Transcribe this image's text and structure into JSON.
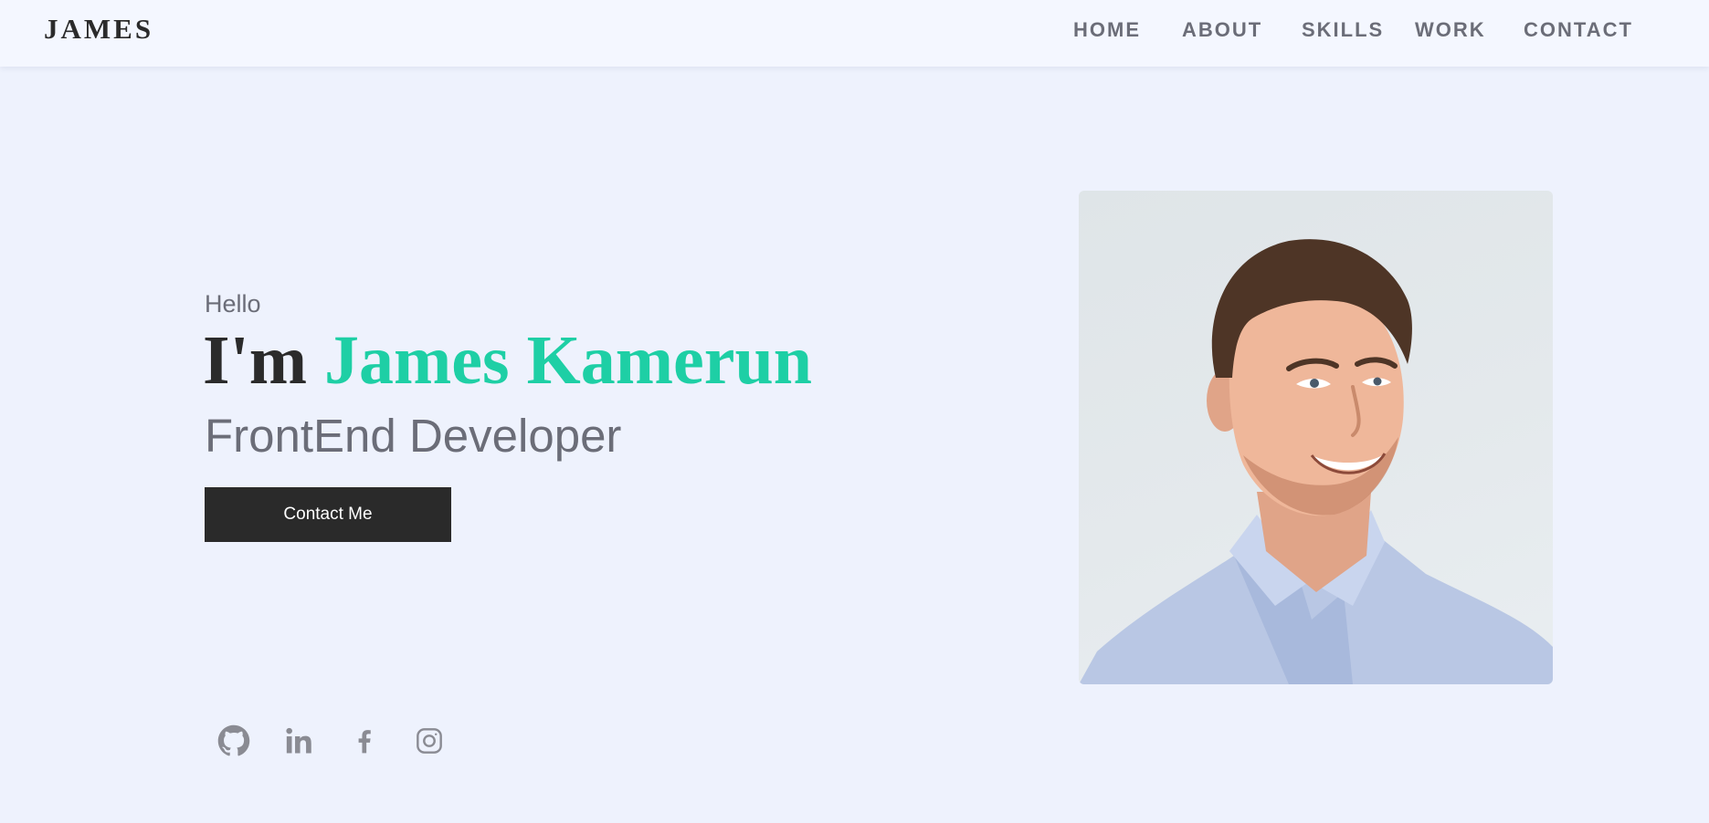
{
  "header": {
    "logo": "JAMES",
    "nav": [
      "HOME",
      "ABOUT",
      "SKILLS",
      "WORK",
      "CONTACT"
    ]
  },
  "hero": {
    "greeting": "Hello",
    "headline_prefix": "I'm",
    "name": "James Kamerun",
    "role": "FrontEnd Developer",
    "cta_label": "Contact Me"
  },
  "socials": [
    "github-icon",
    "linkedin-icon",
    "facebook-icon",
    "instagram-icon"
  ],
  "colors": {
    "background": "#eef2fd",
    "navbar": "#f4f7ff",
    "accent": "#1ecfa5",
    "text_dark": "#2b2b2b",
    "text_muted": "#6b6d78",
    "button": "#2a2a2a",
    "icon": "#8a8b93"
  }
}
